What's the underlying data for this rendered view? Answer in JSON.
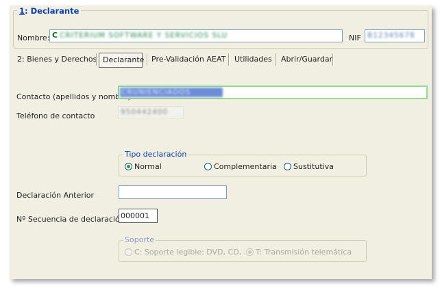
{
  "declarante_section": {
    "legend_number": "1",
    "legend_text": ": Declarante",
    "nombre_label": "Nombre:",
    "nombre_first": "C",
    "nombre_value": "CRITERIUM SOFTWARE Y SERVICIOS SLU",
    "nif_label": "NIF",
    "nif_value": "B12345678"
  },
  "tabs": [
    {
      "label": "2: Bienes y Derechos",
      "active": false
    },
    {
      "label": "Declarante",
      "active": true
    },
    {
      "label": "Pre-Validación AEAT",
      "active": false
    },
    {
      "label": "Utilidades",
      "active": false
    },
    {
      "label": "Abrir/Guardar",
      "active": false
    }
  ],
  "contacto": {
    "label": "Contacto (apellidos y nombre)",
    "value": "CRUNIENCIADOS"
  },
  "telefono": {
    "label": "Teléfono de contacto",
    "value": "950442400"
  },
  "tipo_declaracion": {
    "legend": "Tipo declaración",
    "options": [
      {
        "label": "Normal",
        "selected": true
      },
      {
        "label": "Complementaria",
        "selected": false
      },
      {
        "label": "Sustitutiva",
        "selected": false
      }
    ]
  },
  "declaracion_anterior": {
    "label": "Declaración Anterior",
    "value": ""
  },
  "secuencia": {
    "label": "Nº Secuencia de declaración",
    "value": "000001"
  },
  "soporte": {
    "legend": "Soporte",
    "options": [
      {
        "label": "C: Soporte legible: DVD, CD, ...",
        "selected": false
      },
      {
        "label": "T: Transmisión telemática",
        "selected": true
      }
    ]
  }
}
